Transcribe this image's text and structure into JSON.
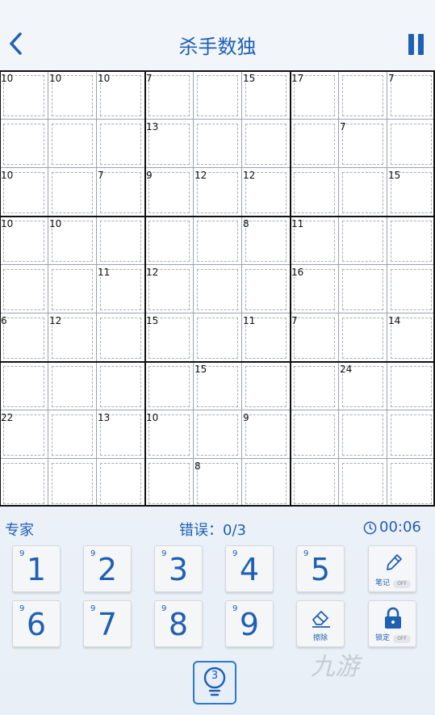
{
  "header": {
    "title": "杀手数独"
  },
  "status": {
    "difficulty": "专家",
    "errors": "错误：0/3",
    "timer": "00:06"
  },
  "cage_sums": [
    {
      "cell": "0,0",
      "sum": "10"
    },
    {
      "cell": "0,1",
      "sum": "10"
    },
    {
      "cell": "0,2",
      "sum": "10"
    },
    {
      "cell": "0,3",
      "sum": "7"
    },
    {
      "cell": "0,5",
      "sum": "15"
    },
    {
      "cell": "0,6",
      "sum": "17"
    },
    {
      "cell": "0,8",
      "sum": "7"
    },
    {
      "cell": "1,3",
      "sum": "13"
    },
    {
      "cell": "1,7",
      "sum": "7"
    },
    {
      "cell": "2,0",
      "sum": "10"
    },
    {
      "cell": "2,2",
      "sum": "7"
    },
    {
      "cell": "2,3",
      "sum": "9"
    },
    {
      "cell": "2,4",
      "sum": "12"
    },
    {
      "cell": "2,5",
      "sum": "12"
    },
    {
      "cell": "2,8",
      "sum": "15"
    },
    {
      "cell": "3,0",
      "sum": "10"
    },
    {
      "cell": "3,1",
      "sum": "10"
    },
    {
      "cell": "3,5",
      "sum": "8"
    },
    {
      "cell": "3,6",
      "sum": "11"
    },
    {
      "cell": "4,2",
      "sum": "11"
    },
    {
      "cell": "4,3",
      "sum": "12"
    },
    {
      "cell": "4,6",
      "sum": "16"
    },
    {
      "cell": "5,0",
      "sum": "6"
    },
    {
      "cell": "5,1",
      "sum": "12"
    },
    {
      "cell": "5,3",
      "sum": "15"
    },
    {
      "cell": "5,5",
      "sum": "11"
    },
    {
      "cell": "5,6",
      "sum": "7"
    },
    {
      "cell": "5,8",
      "sum": "14"
    },
    {
      "cell": "6,4",
      "sum": "15"
    },
    {
      "cell": "6,7",
      "sum": "24"
    },
    {
      "cell": "7,0",
      "sum": "22"
    },
    {
      "cell": "7,2",
      "sum": "13"
    },
    {
      "cell": "7,3",
      "sum": "10"
    },
    {
      "cell": "7,5",
      "sum": "9"
    },
    {
      "cell": "8,4",
      "sum": "8"
    }
  ],
  "keypad": [
    {
      "digit": "1",
      "count": "9"
    },
    {
      "digit": "2",
      "count": "9"
    },
    {
      "digit": "3",
      "count": "9"
    },
    {
      "digit": "4",
      "count": "9"
    },
    {
      "digit": "5",
      "count": "9"
    },
    {
      "digit": "6",
      "count": "9"
    },
    {
      "digit": "7",
      "count": "9"
    },
    {
      "digit": "8",
      "count": "9"
    },
    {
      "digit": "9",
      "count": "9"
    }
  ],
  "tools": {
    "notes": {
      "label": "笔记",
      "toggle": "OFF",
      "icon": "pencil-icon"
    },
    "erase": {
      "label": "擦除",
      "icon": "eraser-icon"
    },
    "lock": {
      "label": "锁定",
      "toggle": "OFF",
      "icon": "lock-icon"
    }
  },
  "hint": {
    "count": "3",
    "icon": "lightbulb-icon"
  },
  "watermark": "九游",
  "colors": {
    "accent": "#1f5fb4",
    "background": "#f2f6fb"
  }
}
